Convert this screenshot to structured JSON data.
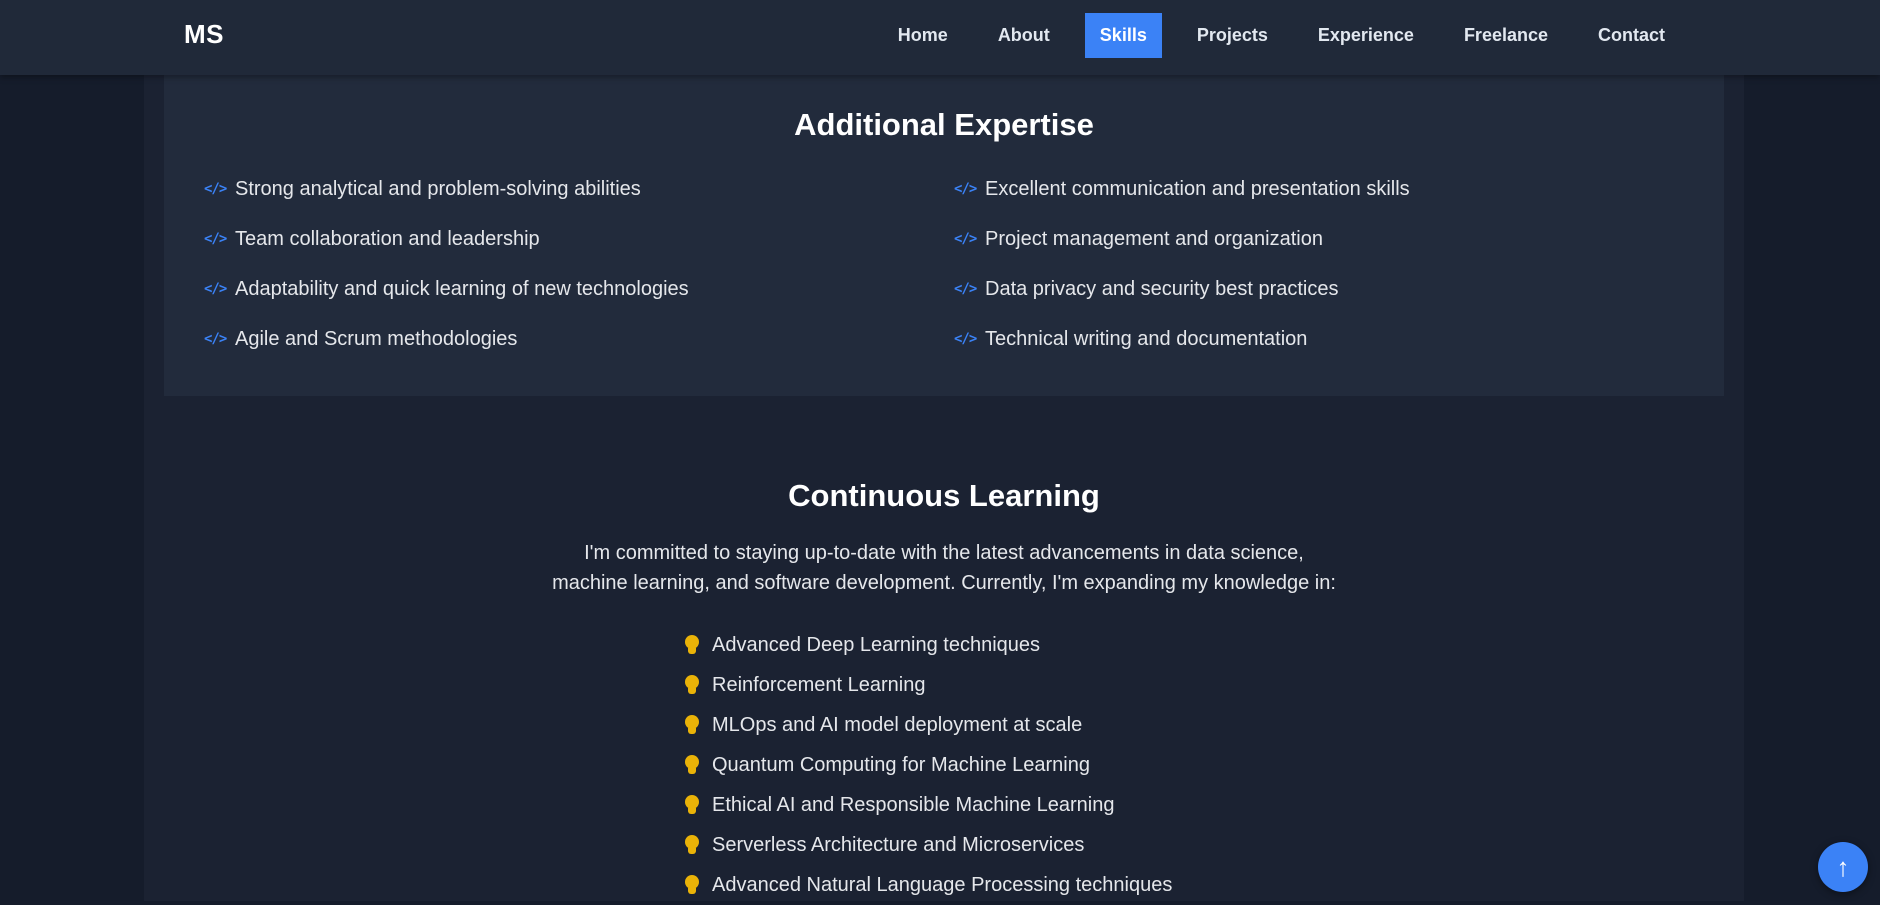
{
  "nav": {
    "logo": "MS",
    "links": [
      {
        "label": "Home",
        "active": false
      },
      {
        "label": "About",
        "active": false
      },
      {
        "label": "Skills",
        "active": true
      },
      {
        "label": "Projects",
        "active": false
      },
      {
        "label": "Experience",
        "active": false
      },
      {
        "label": "Freelance",
        "active": false
      },
      {
        "label": "Contact",
        "active": false
      }
    ]
  },
  "expertise": {
    "title": "Additional Expertise",
    "icon": "code-icon",
    "items": [
      "Strong analytical and problem-solving abilities",
      "Excellent communication and presentation skills",
      "Team collaboration and leadership",
      "Project management and organization",
      "Adaptability and quick learning of new technologies",
      "Data privacy and security best practices",
      "Agile and Scrum methodologies",
      "Technical writing and documentation"
    ]
  },
  "learning": {
    "title": "Continuous Learning",
    "intro_line1": "I'm committed to staying up-to-date with the latest advancements in data science,",
    "intro_line2": "machine learning, and software development. Currently, I'm expanding my knowledge in:",
    "icon": "lightbulb-icon",
    "items": [
      "Advanced Deep Learning techniques",
      "Reinforcement Learning",
      "MLOps and AI model deployment at scale",
      "Quantum Computing for Machine Learning",
      "Ethical AI and Responsible Machine Learning",
      "Serverless Architecture and Microservices",
      "Advanced Natural Language Processing techniques"
    ]
  },
  "scroll_top": {
    "icon": "arrow-up-icon",
    "glyph": "↑"
  },
  "colors": {
    "accent": "#3b82f6",
    "bulb": "#eab308",
    "nav_bg": "#202939",
    "card_bg": "#222b3c",
    "page_bg": "#151c2b"
  }
}
